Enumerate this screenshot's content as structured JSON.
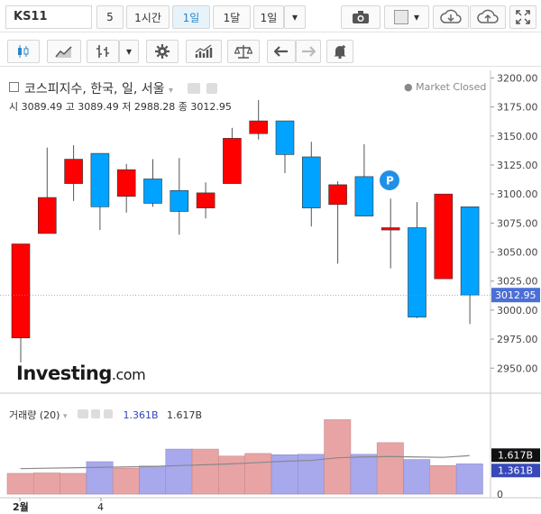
{
  "toolbar": {
    "symbol": "KS11",
    "intervals": [
      "5",
      "1시간",
      "1일",
      "1달",
      "1일"
    ],
    "active_interval": "1일"
  },
  "legend": {
    "title": "코스피지수, 한국, 일, 서울",
    "status": "Market Closed",
    "ohlc": "시 3089.49  고 3089.49  저 2988.28  종 3012.95",
    "brand": "Investing",
    "brand_suffix": ".com"
  },
  "volume_legend": {
    "title": "거래량 (20)",
    "val1": "1.361B",
    "val2": "1.617B"
  },
  "price_axis": {
    "ticks": [
      "3200.00",
      "3175.00",
      "3150.00",
      "3125.00",
      "3100.00",
      "3075.00",
      "3050.00",
      "3025.00",
      "3000.00",
      "2975.00",
      "2950.00"
    ],
    "last_price": "3012.95"
  },
  "volume_axis": {
    "ticks": [
      "0"
    ],
    "badge_top": "1.617B",
    "badge_bottom": "1.361B"
  },
  "x_axis": {
    "labels": [
      "2월",
      "4"
    ]
  },
  "marker": "P",
  "colors": {
    "up": "#ff0000",
    "down": "#00a3ff",
    "vol_up": "#e8a4a4",
    "vol_down": "#a8a8ec",
    "ma": "#888888"
  },
  "chart_data": {
    "type": "candlestick",
    "title": "코스피지수, 한국, 일, 서울",
    "ylim": [
      2930,
      3205
    ],
    "candles": [
      {
        "open": 2976,
        "high": 3057,
        "low": 2955,
        "close": 3057
      },
      {
        "open": 3066,
        "high": 3140,
        "low": 3066,
        "close": 3097
      },
      {
        "open": 3109,
        "high": 3142,
        "low": 3094,
        "close": 3130
      },
      {
        "open": 3135,
        "high": 3135,
        "low": 3069,
        "close": 3089
      },
      {
        "open": 3098,
        "high": 3126,
        "low": 3084,
        "close": 3121
      },
      {
        "open": 3113,
        "high": 3130,
        "low": 3089,
        "close": 3092
      },
      {
        "open": 3103,
        "high": 3131,
        "low": 3065,
        "close": 3085
      },
      {
        "open": 3088,
        "high": 3110,
        "low": 3079,
        "close": 3101
      },
      {
        "open": 3109,
        "high": 3157,
        "low": 3109,
        "close": 3148
      },
      {
        "open": 3152,
        "high": 3181,
        "low": 3147,
        "close": 3163
      },
      {
        "open": 3163,
        "high": 3163,
        "low": 3118,
        "close": 3134
      },
      {
        "open": 3132,
        "high": 3145,
        "low": 3072,
        "close": 3088
      },
      {
        "open": 3091,
        "high": 3111,
        "low": 3040,
        "close": 3108
      },
      {
        "open": 3115,
        "high": 3143,
        "low": 3081,
        "close": 3081
      },
      {
        "open": 3069,
        "high": 3096,
        "low": 3036,
        "close": 3071
      },
      {
        "open": 3071,
        "high": 3093,
        "low": 2993,
        "close": 2994
      },
      {
        "open": 3027,
        "high": 3100,
        "low": 3027,
        "close": 3100
      },
      {
        "open": 3089,
        "high": 3089,
        "low": 2988,
        "close": 3013
      }
    ],
    "volume": [
      0.48,
      0.49,
      0.48,
      0.75,
      0.6,
      0.65,
      1.04,
      1.04,
      0.88,
      0.94,
      0.91,
      0.92,
      1.72,
      0.92,
      1.19,
      0.8,
      0.66,
      0.7
    ],
    "volume_ma": [
      0.59,
      0.6,
      0.61,
      0.62,
      0.63,
      0.64,
      0.66,
      0.68,
      0.7,
      0.73,
      0.76,
      0.78,
      0.84,
      0.86,
      0.87,
      0.86,
      0.85,
      0.89
    ],
    "vol_max": 2.0
  }
}
